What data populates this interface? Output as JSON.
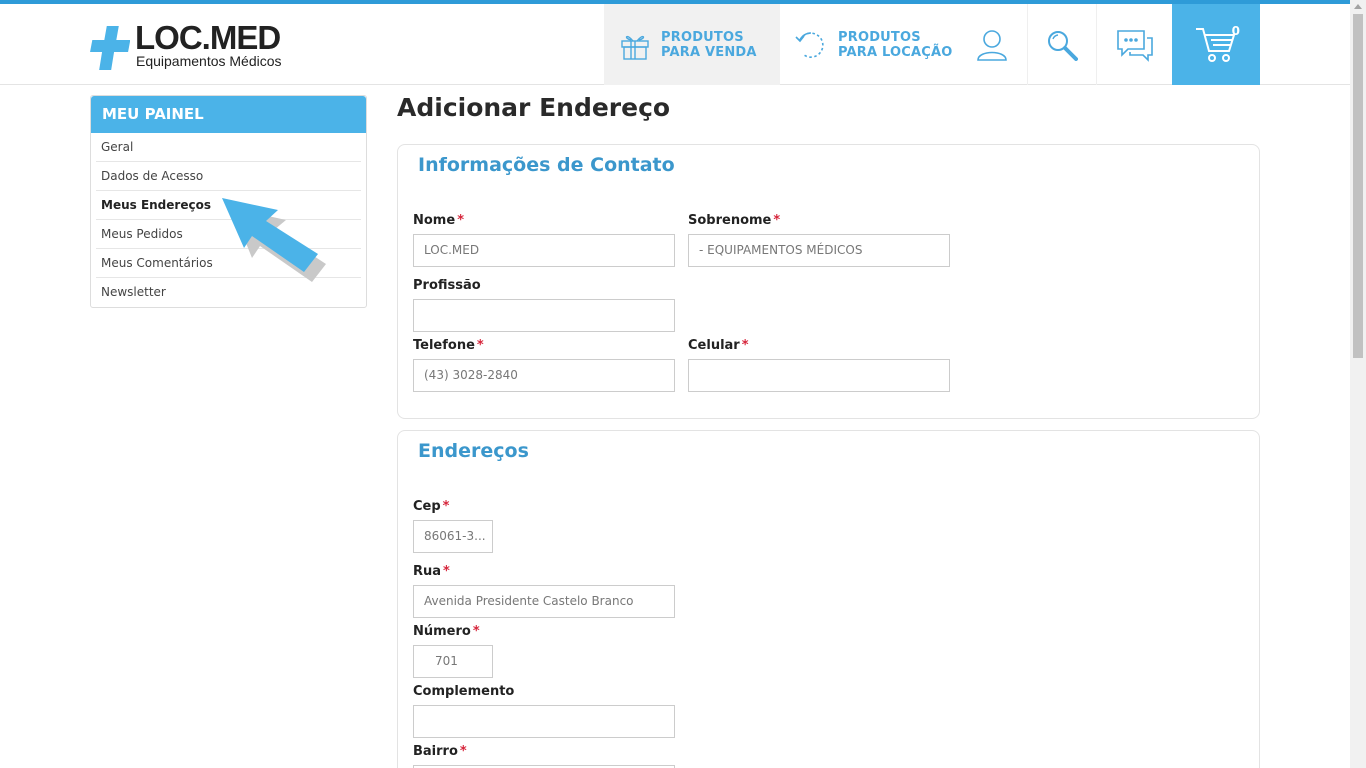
{
  "header": {
    "brand": {
      "title": "LOC.MED",
      "subtitle": "Equipamentos Médicos",
      "logo_icon": "medical-cross"
    },
    "nav": {
      "venda": {
        "line1": "PRODUTOS",
        "line2": "PARA VENDA",
        "icon": "gift-icon"
      },
      "locacao": {
        "line1": "PRODUTOS",
        "line2": "PARA LOCAÇÃO",
        "icon": "refresh-icon"
      }
    },
    "icons": [
      "user-icon",
      "search-icon",
      "chat-icon",
      "cart-icon"
    ],
    "cart_count": "0"
  },
  "sidebar": {
    "title": "MEU PAINEL",
    "items": [
      {
        "label": "Geral"
      },
      {
        "label": "Dados de Acesso"
      },
      {
        "label": "Meus Endereços",
        "active": true
      },
      {
        "label": "Meus Pedidos"
      },
      {
        "label": "Meus Comentários"
      },
      {
        "label": "Newsletter"
      }
    ]
  },
  "page": {
    "title": "Adicionar Endereço"
  },
  "contact": {
    "title": "Informações de Contato",
    "fields": {
      "nome": {
        "label": "Nome",
        "value": "LOC.MED"
      },
      "sobrenome": {
        "label": "Sobrenome",
        "value": "- EQUIPAMENTOS MÉDICOS"
      },
      "profissao": {
        "label": "Profissão",
        "value": ""
      },
      "telefone": {
        "label": "Telefone",
        "value": "(43) 3028-2840"
      },
      "celular": {
        "label": "Celular",
        "value": ""
      }
    }
  },
  "address": {
    "title": "Endereços",
    "fields": {
      "cep": {
        "label": "Cep",
        "value": "86061-3..."
      },
      "rua": {
        "label": "Rua",
        "value": "Avenida Presidente Castelo Branco"
      },
      "numero": {
        "label": "Número",
        "value": "701"
      },
      "complemento": {
        "label": "Complemento",
        "value": ""
      },
      "bairro": {
        "label": "Bairro",
        "value": ""
      }
    }
  },
  "required_mark": "*",
  "colors": {
    "brand_blue": "#4bb3e8",
    "title_blue": "#3b97cc",
    "required_red": "#d6253b"
  }
}
